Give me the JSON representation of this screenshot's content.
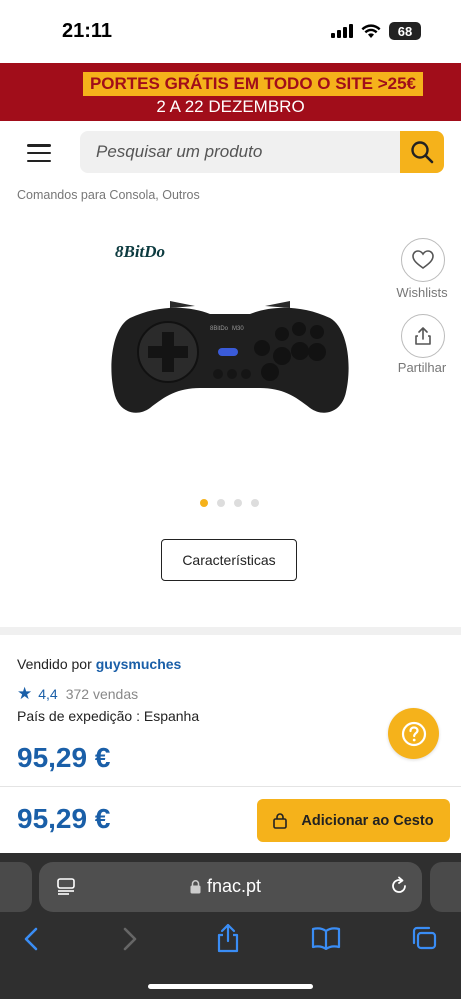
{
  "status": {
    "time": "21:11",
    "battery": "68"
  },
  "promo": {
    "line1": "PORTES GRÁTIS EM TODO O SITE >25€",
    "line2": "2 A 22 DEZEMBRO"
  },
  "search": {
    "placeholder": "Pesquisar um produto"
  },
  "breadcrumb": "Comandos para Consola, Outros",
  "product": {
    "brand": "8BitDo",
    "wishlist_label": "Wishlists",
    "share_label": "Partilhar",
    "gallery": {
      "total": 4,
      "active": 1
    },
    "features_button": "Características"
  },
  "seller": {
    "prefix": "Vendido por",
    "name": "guysmuches",
    "rating": "4,4",
    "sales": "372 vendas",
    "country": "País de expedição : Espanha"
  },
  "price": "95,29 €",
  "sticky": {
    "price": "95,29 €",
    "cart_label": "Adicionar ao Cesto"
  },
  "browser": {
    "url": "fnac.pt"
  },
  "colors": {
    "accent": "#f5b21b",
    "brand_red": "#a10d1a",
    "link_blue": "#1a5fa8"
  }
}
